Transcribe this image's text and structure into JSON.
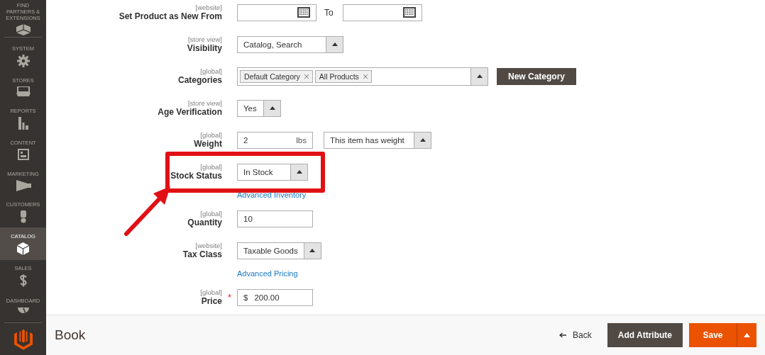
{
  "sidebar": {
    "items": [
      {
        "label": "FIND PARTNERS & EXTENSIONS",
        "selected": false
      },
      {
        "label": "SYSTEM",
        "selected": false
      },
      {
        "label": "STORES",
        "selected": false
      },
      {
        "label": "REPORTS",
        "selected": false
      },
      {
        "label": "CONTENT",
        "selected": false
      },
      {
        "label": "MARKETING",
        "selected": false
      },
      {
        "label": "CUSTOMERS",
        "selected": false
      },
      {
        "label": "CATALOG",
        "selected": true
      },
      {
        "label": "SALES",
        "selected": false
      },
      {
        "label": "DASHBOARD",
        "selected": false
      }
    ]
  },
  "fields": [
    {
      "kind": "date_range",
      "label": "Set Product as New From",
      "scope": "[website]",
      "to_label": "To"
    },
    {
      "kind": "select",
      "label": "Visibility",
      "scope": "[store view]",
      "value": "Catalog, Search"
    },
    {
      "kind": "tags",
      "label": "Categories",
      "scope": "[global]",
      "tags": [
        "Default Category",
        "All Products"
      ],
      "button": "New Category"
    },
    {
      "kind": "select",
      "label": "Age Verification",
      "scope": "[store view]",
      "value": "Yes"
    },
    {
      "kind": "weight",
      "label": "Weight",
      "scope": "[global]",
      "value": "2",
      "unit": "lbs",
      "option": "This item has weight"
    },
    {
      "kind": "select",
      "label": "Stock Status",
      "scope": "[global]",
      "value": "In Stock",
      "highlighted": true
    },
    {
      "kind": "text",
      "label": "Quantity",
      "scope": "[global]",
      "value": "10",
      "link": "Advanced Inventory"
    },
    {
      "kind": "select",
      "label": "Tax Class",
      "scope": "[website]",
      "value": "Taxable Goods"
    },
    {
      "kind": "price",
      "label": "Price",
      "scope": "[global]",
      "required_mark": "*",
      "currency": "$",
      "value": "200.00",
      "link": "Advanced Pricing"
    }
  ],
  "header": {
    "title": "Book",
    "back": "Back",
    "add_attribute": "Add Attribute",
    "save": "Save"
  }
}
